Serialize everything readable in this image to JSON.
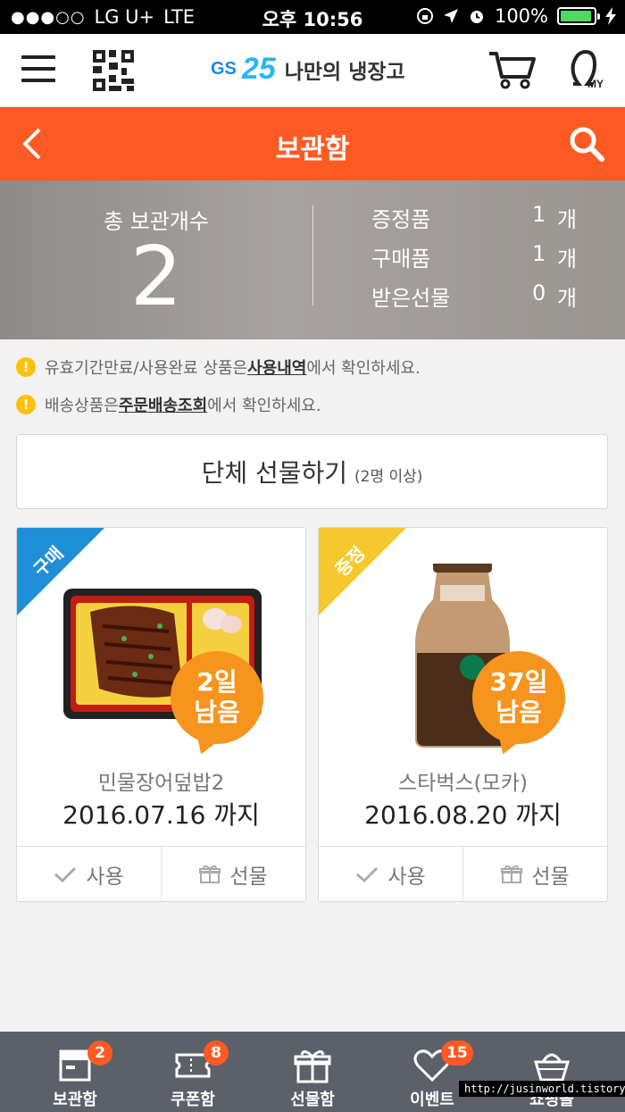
{
  "status_bar": {
    "carrier": "LG U+",
    "network": "LTE",
    "time": "오후 10:56",
    "battery": "100%"
  },
  "header": {
    "brand_gs": "GS",
    "brand_num": "25",
    "brand_title": "나만의 냉장고",
    "my_label": "MY"
  },
  "title_bar": {
    "title": "보관함"
  },
  "summary": {
    "total_label": "총 보관개수",
    "total_count": "2",
    "rows": [
      {
        "label": "증정품",
        "count": "1",
        "unit": "개"
      },
      {
        "label": "구매품",
        "count": "1",
        "unit": "개"
      },
      {
        "label": "받은선물",
        "count": "0",
        "unit": "개"
      }
    ]
  },
  "notices": [
    {
      "prefix": "유효기간만료/사용완료 상품은 ",
      "link": "사용내역",
      "suffix": "에서 확인하세요."
    },
    {
      "prefix": "배송상품은 ",
      "link": "주문배송조회",
      "suffix": "에서 확인하세요."
    }
  ],
  "group_gift": {
    "label": "단체 선물하기",
    "sub": "(2명 이상)"
  },
  "cards": [
    {
      "ribbon": "구매",
      "ribbon_color": "#1e8fd6",
      "days_num": "2일",
      "days_word": "남음",
      "name": "민물장어덮밥2",
      "date": "2016.07.16 까지",
      "use_label": "사용",
      "gift_label": "선물"
    },
    {
      "ribbon": "증정",
      "ribbon_color": "#f5c92e",
      "days_num": "37일",
      "days_word": "남음",
      "name": "스타벅스(모카)",
      "date": "2016.08.20 까지",
      "use_label": "사용",
      "gift_label": "선물"
    }
  ],
  "tabs": [
    {
      "label": "보관함",
      "badge": "2",
      "icon": "storage-icon"
    },
    {
      "label": "쿠폰함",
      "badge": "8",
      "icon": "coupon-icon"
    },
    {
      "label": "선물함",
      "badge": "",
      "icon": "gift-icon"
    },
    {
      "label": "이벤트",
      "badge": "15",
      "icon": "heart-icon"
    },
    {
      "label": "쇼핑몰",
      "badge": "",
      "icon": "basket-icon"
    }
  ],
  "watermark": "http://jusinworld.tistory.com",
  "colors": {
    "accent": "#ff5a23",
    "badge_orange": "#f7941d",
    "tabbar": "#5b6069"
  }
}
